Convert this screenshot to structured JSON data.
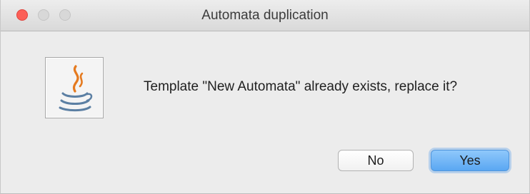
{
  "window": {
    "title": "Automata duplication",
    "controls": {
      "close_color": "#fc5f57",
      "minimize_color": "#d8d8d8",
      "zoom_color": "#d8d8d8"
    }
  },
  "dialog": {
    "icon": "java-coffee-cup-icon",
    "message": "Template \"New Automata\" already exists, replace it?",
    "buttons": {
      "no_label": "No",
      "yes_label": "Yes"
    },
    "colors": {
      "accent": "#5aa7f2",
      "background": "#ececec"
    }
  }
}
